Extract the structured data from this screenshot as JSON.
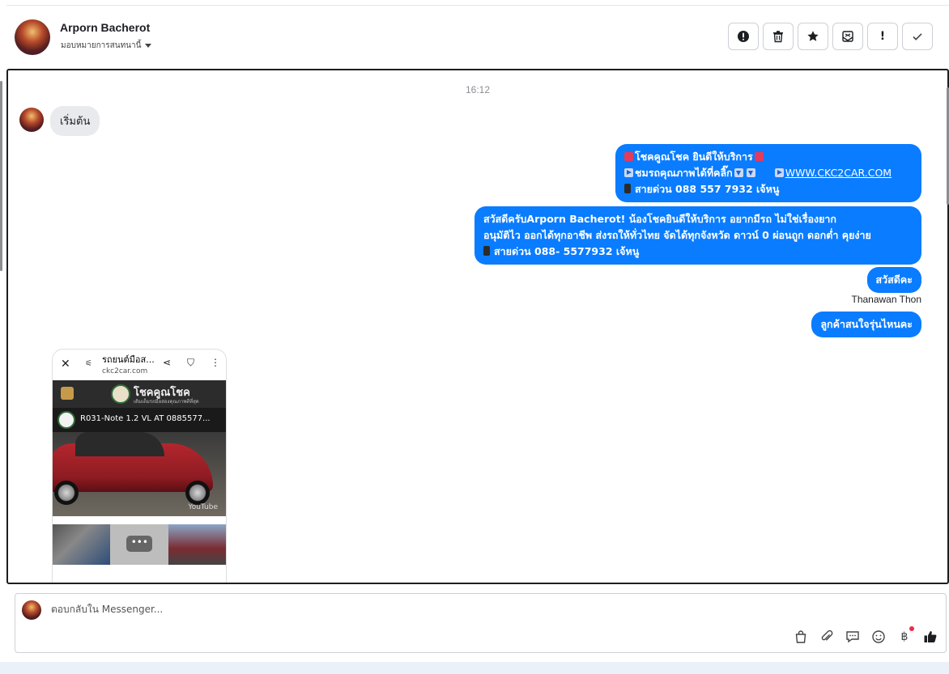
{
  "header": {
    "name": "Arporn Bacherot",
    "assign_label": "มอบหมายการสนทนานี้",
    "toolbar": {
      "spam_icon": "alert-circle-icon",
      "delete_icon": "trash-icon",
      "star_icon": "star-icon",
      "unread_icon": "mail-icon",
      "important_label": "!",
      "done_icon": "check-icon"
    }
  },
  "chat": {
    "timestamp": "16:12",
    "incoming": {
      "text": "เริ่มต้น"
    },
    "outgoing": [
      {
        "line1": "โชคคูณโชค ยินดีให้บริการ",
        "line2a": "ชมรถคุณภาพได้ที่คลิ๊ก",
        "link": "WWW.CKC2CAR.COM",
        "line3": "สายด่วน 088 557 7932 เจ้หนู"
      },
      {
        "line1": "สวัสดีครับArporn Bacherot! น้องโชคยินดีให้บริการ อยากมีรถ ไม่ใช่เรื่องยาก",
        "line2": "อนุมัติไว ออกได้ทุกอาชีพ ส่งรถให้ทั่วไทย จัดได้ทุกจังหวัด ดาวน์ 0  ผ่อนถูก ดอกต่ำ คุยง่าย",
        "line3": "สายด่วน 088- 5577932 เจ้หนู"
      },
      {
        "text": "สวัสดีคะ"
      },
      {
        "text": "ลูกค้าสนใจรุ่นไหนคะ"
      }
    ],
    "sender_name": "Thanawan Thon",
    "screenshot": {
      "page_title": "รถยนต์มือส...",
      "page_url": "ckc2car.com",
      "brand": "โชคคูณโชค",
      "brand_tagline": "เติมเต็มรถมือสองคุณภาพดีที่สุด",
      "video_title": "R031-Note 1.2 VL AT 0885577...",
      "video_platform": "YouTube",
      "more_label": "•••"
    }
  },
  "composer": {
    "placeholder": "ตอบกลับใน Messenger...",
    "tools": [
      "shopping-bag-icon",
      "paperclip-icon",
      "chat-bubble-icon",
      "smiley-icon",
      "baht-icon",
      "thumbs-up-icon"
    ],
    "baht_label": "฿"
  },
  "colors": {
    "outgoing_bubble": "#0a7cff",
    "incoming_bubble": "#e9eaed",
    "notification_dot": "#f02849"
  }
}
